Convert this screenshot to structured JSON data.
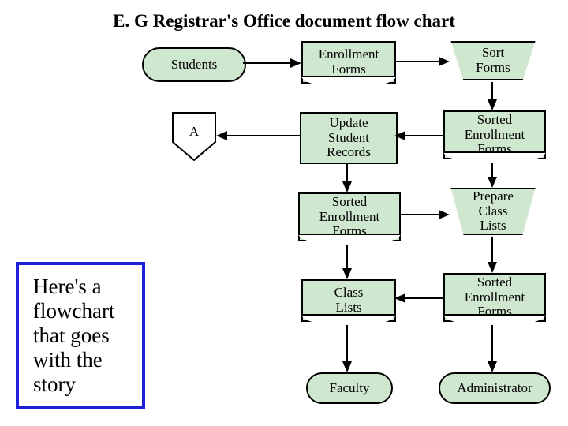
{
  "title": "E. G   Registrar's Office  document flow chart",
  "nodes": {
    "students": "Students",
    "enrollmentForms": "Enrollment\nForms",
    "sortForms": "Sort\nForms",
    "updateStudentRecords": "Update\nStudent\nRecords",
    "sortedEnrollmentForms1": "Sorted\nEnrollment\nForms",
    "sortedEnrollmentForms2": "Sorted\nEnrollment\nForms",
    "sortedEnrollmentForms3": "Sorted\nEnrollment\nForms",
    "prepareClassLists": "Prepare\nClass\nLists",
    "classLists": "Class\nLists",
    "faculty": "Faculty",
    "administrator": "Administrator",
    "offpage": "A"
  },
  "caption": "Here's a flowchart that goes with the story"
}
